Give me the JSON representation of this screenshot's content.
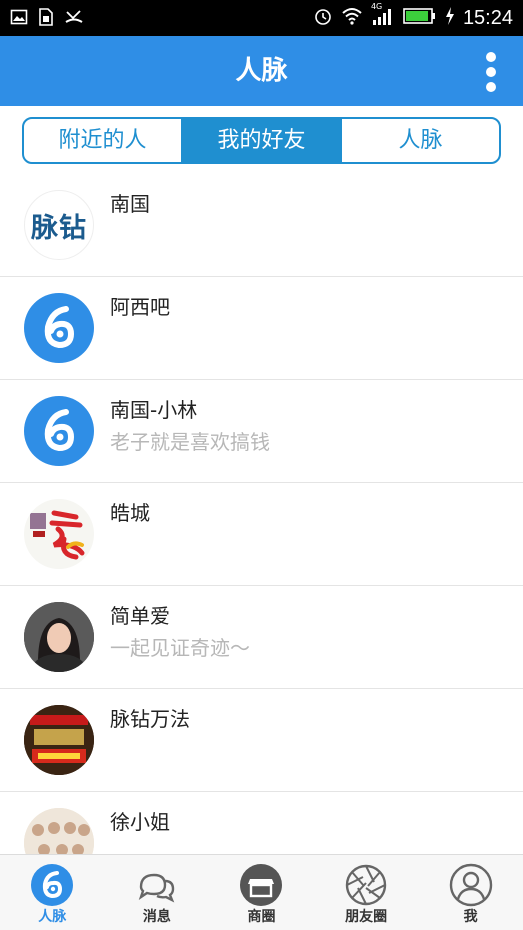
{
  "status_bar": {
    "time": "15:24",
    "network": "4G",
    "left_icons": [
      "image-icon",
      "sim-icon",
      "missed-call-icon"
    ],
    "right_icons": [
      "alarm-icon",
      "wifi-icon",
      "signal-icon",
      "battery-icon",
      "charging-icon"
    ]
  },
  "header": {
    "title": "人脉",
    "menu_icon": "more-vertical-icon",
    "background": "#2f8ee6"
  },
  "tabs": [
    {
      "label": "附近的人",
      "active": false
    },
    {
      "label": "我的好友",
      "active": true
    },
    {
      "label": "人脉",
      "active": false
    }
  ],
  "contacts": [
    {
      "name": "南国",
      "subtitle": "",
      "avatar": "maizuan-logo",
      "avatar_text": "脉钻"
    },
    {
      "name": "阿西吧",
      "subtitle": "",
      "avatar": "six-logo"
    },
    {
      "name": "南国-小林",
      "subtitle": "老子就是喜欢搞钱",
      "avatar": "six-logo"
    },
    {
      "name": "皓城",
      "subtitle": "",
      "avatar": "haocheng-logo"
    },
    {
      "name": "简单爱",
      "subtitle": "一起见证奇迹～",
      "avatar": "user-photo"
    },
    {
      "name": "脉钻万法",
      "subtitle": "",
      "avatar": "game-poster"
    },
    {
      "name": "徐小姐",
      "subtitle": "",
      "avatar": "group-photo"
    }
  ],
  "bottom_nav": [
    {
      "label": "人脉",
      "icon": "six-logo-icon",
      "active": true
    },
    {
      "label": "消息",
      "icon": "chat-bubbles-icon",
      "active": false
    },
    {
      "label": "商圈",
      "icon": "store-icon",
      "active": false
    },
    {
      "label": "朋友圈",
      "icon": "aperture-icon",
      "active": false
    },
    {
      "label": "我",
      "icon": "user-icon",
      "active": false
    }
  ],
  "colors": {
    "accent": "#2f8ee6",
    "tab_accent": "#1f8fd0",
    "subtitle": "#b7b7b7"
  }
}
